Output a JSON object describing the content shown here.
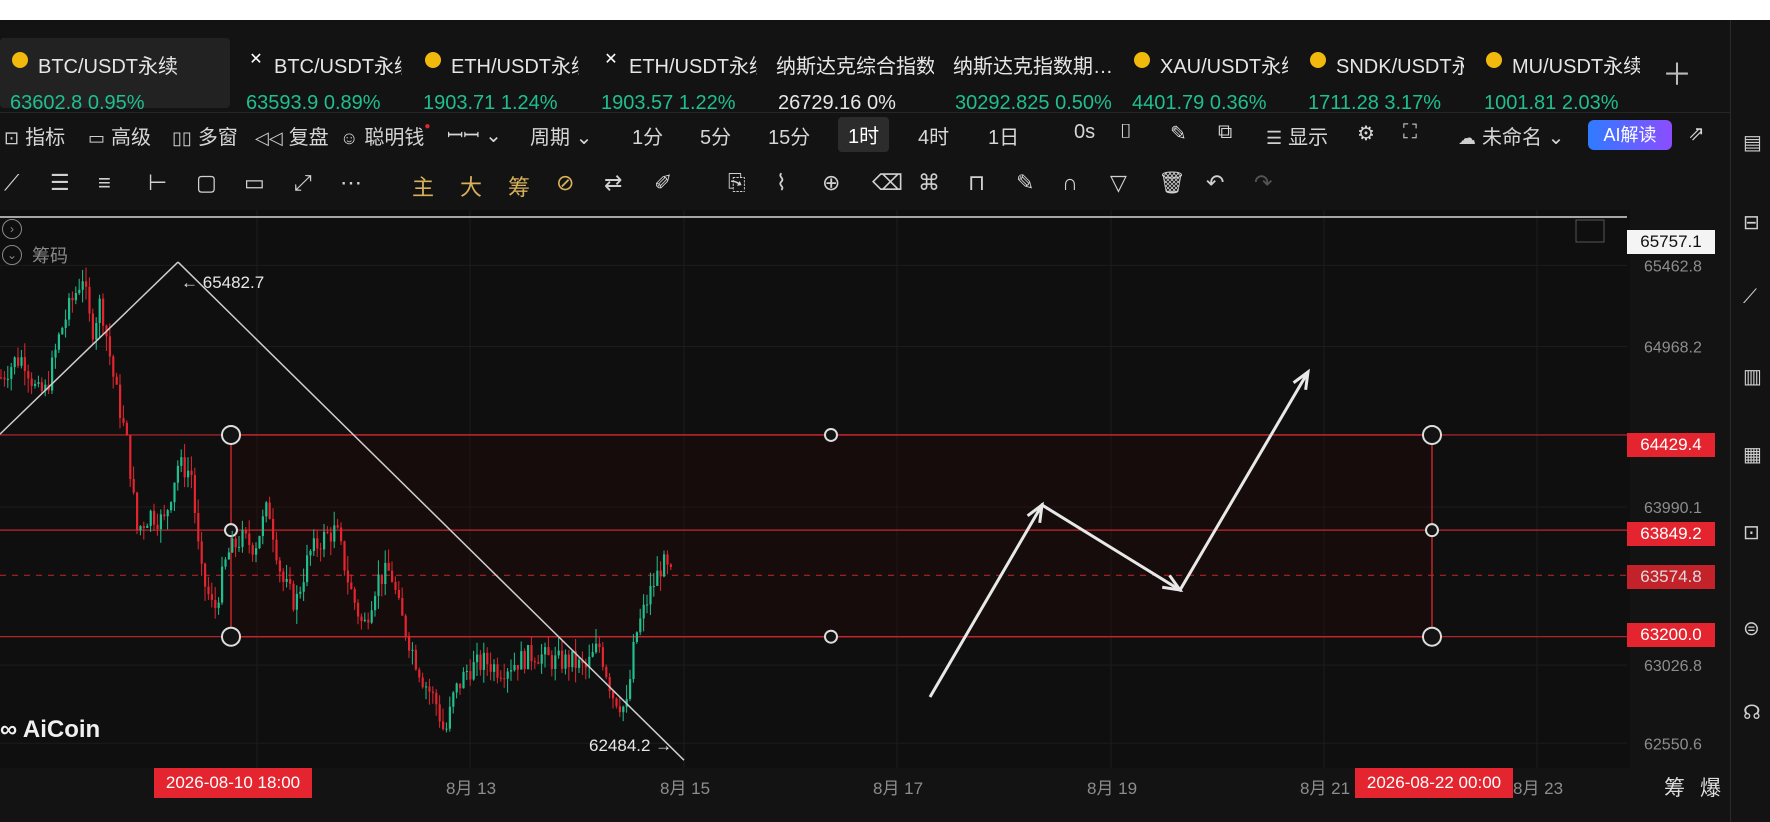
{
  "tabs": [
    {
      "name": "BTC/USDT永续",
      "price": "63602.8",
      "change": "0.95%",
      "icon": "coin-icon",
      "active": true
    },
    {
      "name": "BTC/USDT永续",
      "price": "63593.9",
      "change": "0.89%",
      "icon": "x-icon"
    },
    {
      "name": "ETH/USDT永续",
      "price": "1903.71",
      "change": "1.24%",
      "icon": "coin-icon"
    },
    {
      "name": "ETH/USDT永续",
      "price": "1903.57",
      "change": "1.22%",
      "icon": "x-icon"
    },
    {
      "name": "纳斯达克综合指数",
      "price": "26729.16",
      "change": "0%",
      "icon": "none"
    },
    {
      "name": "纳斯达克指数期…",
      "price": "30292.825",
      "change": "0.50%",
      "icon": "none"
    },
    {
      "name": "XAU/USDT永续",
      "price": "4401.79",
      "change": "0.36%",
      "icon": "coin-icon"
    },
    {
      "name": "SNDK/USDT永续",
      "price": "1711.28",
      "change": "3.17%",
      "icon": "coin-icon"
    },
    {
      "name": "MU/USDT永续",
      "price": "1001.81",
      "change": "2.03%",
      "icon": "coin-icon"
    }
  ],
  "toolbar": {
    "indicators": "指标",
    "advanced": "高级",
    "multi_window": "多窗",
    "replay": "复盘",
    "smart_money": "聪明钱",
    "period": "周期",
    "p1m": "1分",
    "p5m": "5分",
    "p15m": "15分",
    "p1h": "1时",
    "p4h": "4时",
    "p1d": "1日",
    "countdown": "0s",
    "display": "显示",
    "layout_name": "未命名",
    "ai_read": "AI解读"
  },
  "drawtools": {
    "main": "主",
    "big": "大",
    "chips": "筹"
  },
  "chip_label": "筹码",
  "logo": "AiCoin",
  "bottom": {
    "chips": "筹",
    "burst": "爆"
  },
  "chart_data": {
    "type": "candlestick",
    "symbol": "BTC/USDT永续",
    "interval": "1时",
    "y_ticks": [
      65462.8,
      64968.2,
      63990.1,
      63026.8,
      62550.6
    ],
    "ylim": [
      62400,
      65800
    ],
    "x_ticks": [
      "8月 13",
      "8月 15",
      "8月 17",
      "8月 19",
      "8月 21",
      "8月 23"
    ],
    "x_range_start": "2026-08-10 18:00",
    "x_range_end": "2026-08-22 00:00",
    "price_labels": {
      "top_line": "65757.1",
      "box_top": "64429.4",
      "box_mid": "63849.2",
      "last": "63574.8",
      "box_bottom": "63200.0"
    },
    "annotations": {
      "high": "65482.7",
      "low": "62484.2"
    },
    "price_path": [
      {
        "t": 0,
        "p": 64780
      },
      {
        "t": 0.03,
        "p": 64880
      },
      {
        "t": 0.05,
        "p": 64900
      },
      {
        "t": 0.08,
        "p": 64680
      },
      {
        "t": 0.1,
        "p": 64700
      },
      {
        "t": 0.13,
        "p": 65050
      },
      {
        "t": 0.15,
        "p": 65200
      },
      {
        "t": 0.18,
        "p": 65400
      },
      {
        "t": 0.2,
        "p": 65050
      },
      {
        "t": 0.22,
        "p": 65250
      },
      {
        "t": 0.25,
        "p": 64750
      },
      {
        "t": 0.28,
        "p": 64350
      },
      {
        "t": 0.3,
        "p": 63850
      },
      {
        "t": 0.33,
        "p": 63950
      },
      {
        "t": 0.36,
        "p": 63900
      },
      {
        "t": 0.39,
        "p": 64250
      },
      {
        "t": 0.42,
        "p": 64200
      },
      {
        "t": 0.44,
        "p": 63600
      },
      {
        "t": 0.47,
        "p": 63350
      },
      {
        "t": 0.5,
        "p": 63700
      },
      {
        "t": 0.53,
        "p": 63800
      },
      {
        "t": 0.56,
        "p": 63750
      },
      {
        "t": 0.59,
        "p": 64000
      },
      {
        "t": 0.62,
        "p": 63550
      },
      {
        "t": 0.65,
        "p": 63400
      },
      {
        "t": 0.68,
        "p": 63700
      },
      {
        "t": 0.71,
        "p": 63800
      },
      {
        "t": 0.74,
        "p": 63850
      },
      {
        "t": 0.77,
        "p": 63500
      },
      {
        "t": 0.8,
        "p": 63250
      },
      {
        "t": 0.83,
        "p": 63550
      },
      {
        "t": 0.86,
        "p": 63600
      },
      {
        "t": 0.88,
        "p": 63350
      },
      {
        "t": 0.91,
        "p": 63100
      },
      {
        "t": 0.93,
        "p": 62950
      },
      {
        "t": 0.96,
        "p": 62800
      },
      {
        "t": 0.98,
        "p": 62600
      },
      {
        "t": 1.0,
        "p": 62850
      },
      {
        "t": 1.03,
        "p": 63000
      },
      {
        "t": 1.07,
        "p": 63050
      },
      {
        "t": 1.1,
        "p": 63000
      },
      {
        "t": 1.14,
        "p": 63050
      },
      {
        "t": 1.18,
        "p": 63100
      },
      {
        "t": 1.22,
        "p": 63050
      },
      {
        "t": 1.26,
        "p": 63050
      },
      {
        "t": 1.29,
        "p": 63000
      },
      {
        "t": 1.32,
        "p": 63150
      },
      {
        "t": 1.35,
        "p": 62850
      },
      {
        "t": 1.38,
        "p": 62750
      },
      {
        "t": 1.4,
        "p": 63200
      },
      {
        "t": 1.43,
        "p": 63450
      },
      {
        "t": 1.46,
        "p": 63650
      },
      {
        "t": 1.48,
        "p": 63560
      }
    ]
  }
}
